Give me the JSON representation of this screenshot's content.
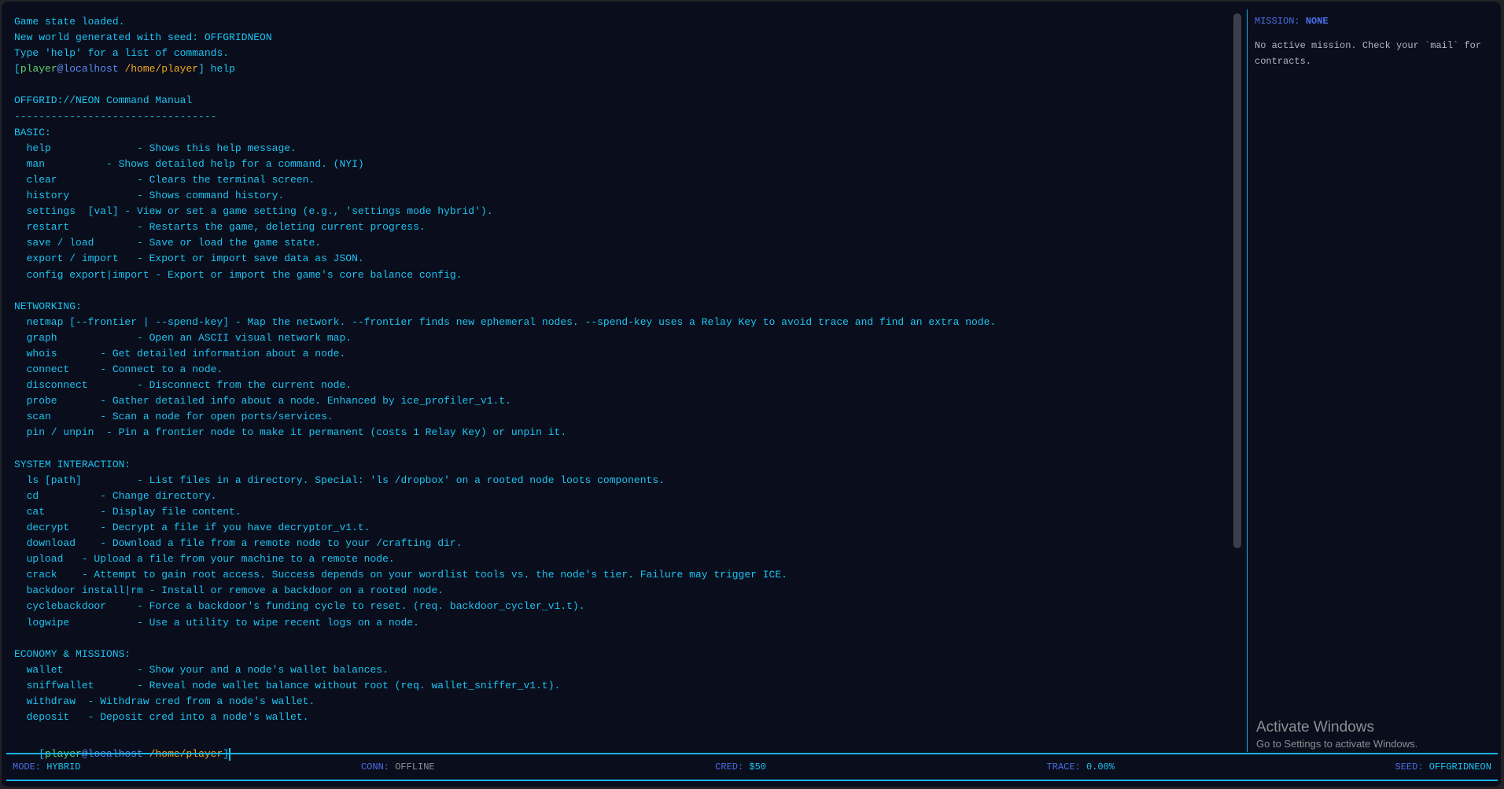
{
  "terminal": {
    "lines": [
      "Game state loaded.",
      "New world generated with seed: OFFGRIDNEON",
      "Type 'help' for a list of commands.",
      null,
      "",
      "OFFGRID://NEON Command Manual",
      "---------------------------------",
      "BASIC:",
      "  help              - Shows this help message.",
      "  man          - Shows detailed help for a command. (NYI)",
      "  clear             - Clears the terminal screen.",
      "  history           - Shows command history.",
      "  settings  [val] - View or set a game setting (e.g., 'settings mode hybrid').",
      "  restart           - Restarts the game, deleting current progress.",
      "  save / load       - Save or load the game state.",
      "  export / import   - Export or import save data as JSON.",
      "  config export|import - Export or import the game's core balance config.",
      "",
      "NETWORKING:",
      "  netmap [--frontier | --spend-key] - Map the network. --frontier finds new ephemeral nodes. --spend-key uses a Relay Key to avoid trace and find an extra node.",
      "  graph             - Open an ASCII visual network map.",
      "  whois       - Get detailed information about a node.",
      "  connect     - Connect to a node.",
      "  disconnect        - Disconnect from the current node.",
      "  probe       - Gather detailed info about a node. Enhanced by ice_profiler_v1.t.",
      "  scan        - Scan a node for open ports/services.",
      "  pin / unpin  - Pin a frontier node to make it permanent (costs 1 Relay Key) or unpin it.",
      "",
      "SYSTEM INTERACTION:",
      "  ls [path]         - List files in a directory. Special: 'ls /dropbox' on a rooted node loots components.",
      "  cd          - Change directory.",
      "  cat         - Display file content.",
      "  decrypt     - Decrypt a file if you have decryptor_v1.t.",
      "  download    - Download a file from a remote node to your /crafting dir.",
      "  upload   - Upload a file from your machine to a remote node.",
      "  crack    - Attempt to gain root access. Success depends on your wordlist tools vs. the node's tier. Failure may trigger ICE.",
      "  backdoor install|rm - Install or remove a backdoor on a rooted node.",
      "  cyclebackdoor     - Force a backdoor's funding cycle to reset. (req. backdoor_cycler_v1.t).",
      "  logwipe           - Use a utility to wipe recent logs on a node.",
      "",
      "ECONOMY & MISSIONS:",
      "  wallet            - Show your and a node's wallet balances.",
      "  sniffwallet       - Reveal node wallet balance without root (req. wallet_sniffer_v1.t).",
      "  withdraw  - Withdraw cred from a node's wallet.",
      "  deposit   - Deposit cred into a node's wallet."
    ],
    "prompt": {
      "open": "[",
      "user": "player",
      "host": "@localhost",
      "path": " /home/player",
      "close": "]",
      "history_command": " help"
    }
  },
  "mission": {
    "label": "MISSION: ",
    "value": "NONE",
    "body": "No active mission. Check your `mail` for contracts."
  },
  "status": {
    "mode_label": "MODE: ",
    "mode": "HYBRID",
    "conn_label": "CONN: ",
    "conn": "OFFLINE",
    "cred_label": "CRED: ",
    "cred": "$50",
    "trace_label": "TRACE: ",
    "trace": "0.00%",
    "seed_label": "SEED: ",
    "seed": "OFFGRIDNEON"
  },
  "watermark": {
    "title": "Activate Windows",
    "subtitle": "Go to Settings to activate Windows."
  },
  "colors": {
    "accent": "#1cc3f2",
    "label": "#4a6ee6",
    "user": "#5fd36a",
    "path": "#f0a81e",
    "background": "#0a0d1b"
  }
}
